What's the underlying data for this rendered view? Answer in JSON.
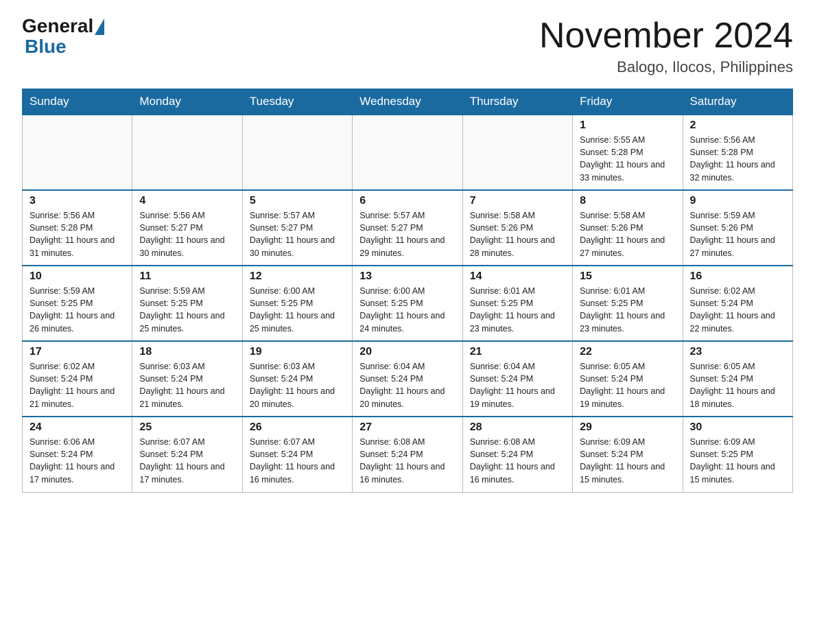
{
  "header": {
    "logo_general": "General",
    "logo_blue": "Blue",
    "month_title": "November 2024",
    "location": "Balogo, Ilocos, Philippines"
  },
  "weekdays": [
    "Sunday",
    "Monday",
    "Tuesday",
    "Wednesday",
    "Thursday",
    "Friday",
    "Saturday"
  ],
  "weeks": [
    [
      {
        "day": "",
        "info": ""
      },
      {
        "day": "",
        "info": ""
      },
      {
        "day": "",
        "info": ""
      },
      {
        "day": "",
        "info": ""
      },
      {
        "day": "",
        "info": ""
      },
      {
        "day": "1",
        "info": "Sunrise: 5:55 AM\nSunset: 5:28 PM\nDaylight: 11 hours and 33 minutes."
      },
      {
        "day": "2",
        "info": "Sunrise: 5:56 AM\nSunset: 5:28 PM\nDaylight: 11 hours and 32 minutes."
      }
    ],
    [
      {
        "day": "3",
        "info": "Sunrise: 5:56 AM\nSunset: 5:28 PM\nDaylight: 11 hours and 31 minutes."
      },
      {
        "day": "4",
        "info": "Sunrise: 5:56 AM\nSunset: 5:27 PM\nDaylight: 11 hours and 30 minutes."
      },
      {
        "day": "5",
        "info": "Sunrise: 5:57 AM\nSunset: 5:27 PM\nDaylight: 11 hours and 30 minutes."
      },
      {
        "day": "6",
        "info": "Sunrise: 5:57 AM\nSunset: 5:27 PM\nDaylight: 11 hours and 29 minutes."
      },
      {
        "day": "7",
        "info": "Sunrise: 5:58 AM\nSunset: 5:26 PM\nDaylight: 11 hours and 28 minutes."
      },
      {
        "day": "8",
        "info": "Sunrise: 5:58 AM\nSunset: 5:26 PM\nDaylight: 11 hours and 27 minutes."
      },
      {
        "day": "9",
        "info": "Sunrise: 5:59 AM\nSunset: 5:26 PM\nDaylight: 11 hours and 27 minutes."
      }
    ],
    [
      {
        "day": "10",
        "info": "Sunrise: 5:59 AM\nSunset: 5:25 PM\nDaylight: 11 hours and 26 minutes."
      },
      {
        "day": "11",
        "info": "Sunrise: 5:59 AM\nSunset: 5:25 PM\nDaylight: 11 hours and 25 minutes."
      },
      {
        "day": "12",
        "info": "Sunrise: 6:00 AM\nSunset: 5:25 PM\nDaylight: 11 hours and 25 minutes."
      },
      {
        "day": "13",
        "info": "Sunrise: 6:00 AM\nSunset: 5:25 PM\nDaylight: 11 hours and 24 minutes."
      },
      {
        "day": "14",
        "info": "Sunrise: 6:01 AM\nSunset: 5:25 PM\nDaylight: 11 hours and 23 minutes."
      },
      {
        "day": "15",
        "info": "Sunrise: 6:01 AM\nSunset: 5:25 PM\nDaylight: 11 hours and 23 minutes."
      },
      {
        "day": "16",
        "info": "Sunrise: 6:02 AM\nSunset: 5:24 PM\nDaylight: 11 hours and 22 minutes."
      }
    ],
    [
      {
        "day": "17",
        "info": "Sunrise: 6:02 AM\nSunset: 5:24 PM\nDaylight: 11 hours and 21 minutes."
      },
      {
        "day": "18",
        "info": "Sunrise: 6:03 AM\nSunset: 5:24 PM\nDaylight: 11 hours and 21 minutes."
      },
      {
        "day": "19",
        "info": "Sunrise: 6:03 AM\nSunset: 5:24 PM\nDaylight: 11 hours and 20 minutes."
      },
      {
        "day": "20",
        "info": "Sunrise: 6:04 AM\nSunset: 5:24 PM\nDaylight: 11 hours and 20 minutes."
      },
      {
        "day": "21",
        "info": "Sunrise: 6:04 AM\nSunset: 5:24 PM\nDaylight: 11 hours and 19 minutes."
      },
      {
        "day": "22",
        "info": "Sunrise: 6:05 AM\nSunset: 5:24 PM\nDaylight: 11 hours and 19 minutes."
      },
      {
        "day": "23",
        "info": "Sunrise: 6:05 AM\nSunset: 5:24 PM\nDaylight: 11 hours and 18 minutes."
      }
    ],
    [
      {
        "day": "24",
        "info": "Sunrise: 6:06 AM\nSunset: 5:24 PM\nDaylight: 11 hours and 17 minutes."
      },
      {
        "day": "25",
        "info": "Sunrise: 6:07 AM\nSunset: 5:24 PM\nDaylight: 11 hours and 17 minutes."
      },
      {
        "day": "26",
        "info": "Sunrise: 6:07 AM\nSunset: 5:24 PM\nDaylight: 11 hours and 16 minutes."
      },
      {
        "day": "27",
        "info": "Sunrise: 6:08 AM\nSunset: 5:24 PM\nDaylight: 11 hours and 16 minutes."
      },
      {
        "day": "28",
        "info": "Sunrise: 6:08 AM\nSunset: 5:24 PM\nDaylight: 11 hours and 16 minutes."
      },
      {
        "day": "29",
        "info": "Sunrise: 6:09 AM\nSunset: 5:24 PM\nDaylight: 11 hours and 15 minutes."
      },
      {
        "day": "30",
        "info": "Sunrise: 6:09 AM\nSunset: 5:25 PM\nDaylight: 11 hours and 15 minutes."
      }
    ]
  ]
}
